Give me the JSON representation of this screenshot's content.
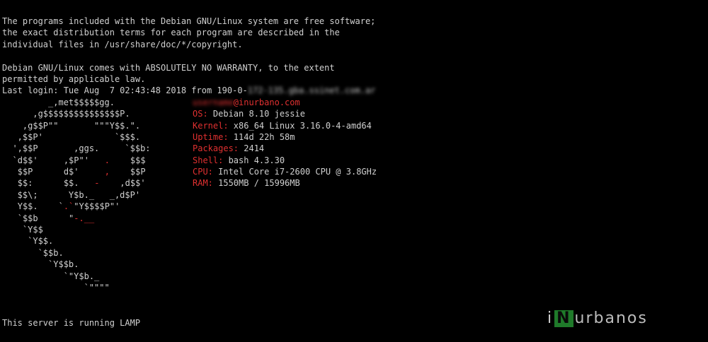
{
  "motd": [
    "The programs included with the Debian GNU/Linux system are free software;",
    "the exact distribution terms for each program are described in the",
    "individual files in /usr/share/doc/*/copyright.",
    "",
    "Debian GNU/Linux comes with ABSOLUTELY NO WARRANTY, to the extent",
    "permitted by applicable law."
  ],
  "last_login": {
    "prefix": "Last login: Tue Aug  7 02:43:48 2018 from 190-0-",
    "host_blurred": "172-135.gba.ssinet.com.ar"
  },
  "art": {
    "lines": [
      "         _,met$$$$$gg.",
      "      ,g$$$$$$$$$$$$$$$P.",
      "    ,g$$P\"\"       \"\"\"Y$$.\".",
      "   ,$$P'              `$$$.",
      "  ',$$P       ,ggs.     `$$b:",
      "  `d$$'     ,$P\"'   .    $$$",
      "   $$P      d$'     ,    $$P",
      "   $$:      $$.   -    ,d$$'",
      "   $$\\;      Y$b._   _,d$P'",
      "   Y$$.    `.`\"Y$$$$P\"'",
      "   `$$b      \"-.__",
      "    `Y$$",
      "     `Y$$.",
      "       `$$b.",
      "         `Y$$b.",
      "            `\"Y$b._",
      "                `\"\"\"\""
    ]
  },
  "sysinfo": {
    "user_blurred": "username",
    "host": "@inurbano.com",
    "rows": [
      {
        "key": "OS:",
        "value": " Debian 8.10 jessie"
      },
      {
        "key": "Kernel:",
        "value": " x86_64 Linux 3.16.0-4-amd64"
      },
      {
        "key": "Uptime:",
        "value": " 114d 22h 58m"
      },
      {
        "key": "Packages:",
        "value": " 2414"
      },
      {
        "key": "Shell:",
        "value": " bash 4.3.30"
      },
      {
        "key": "CPU:",
        "value": " Intel Core i7-2600 CPU @ 3.8GHz"
      },
      {
        "key": "RAM:",
        "value": " 1550MB / 15996MB"
      }
    ]
  },
  "footer_line": "This server is running LAMP",
  "logo": {
    "i": "i",
    "n": "N",
    "rest": "urbanos"
  },
  "colors": {
    "background": "#000000",
    "text": "#d0d0d0",
    "accent_red": "#e03030",
    "logo_green": "#1f7a2a"
  }
}
